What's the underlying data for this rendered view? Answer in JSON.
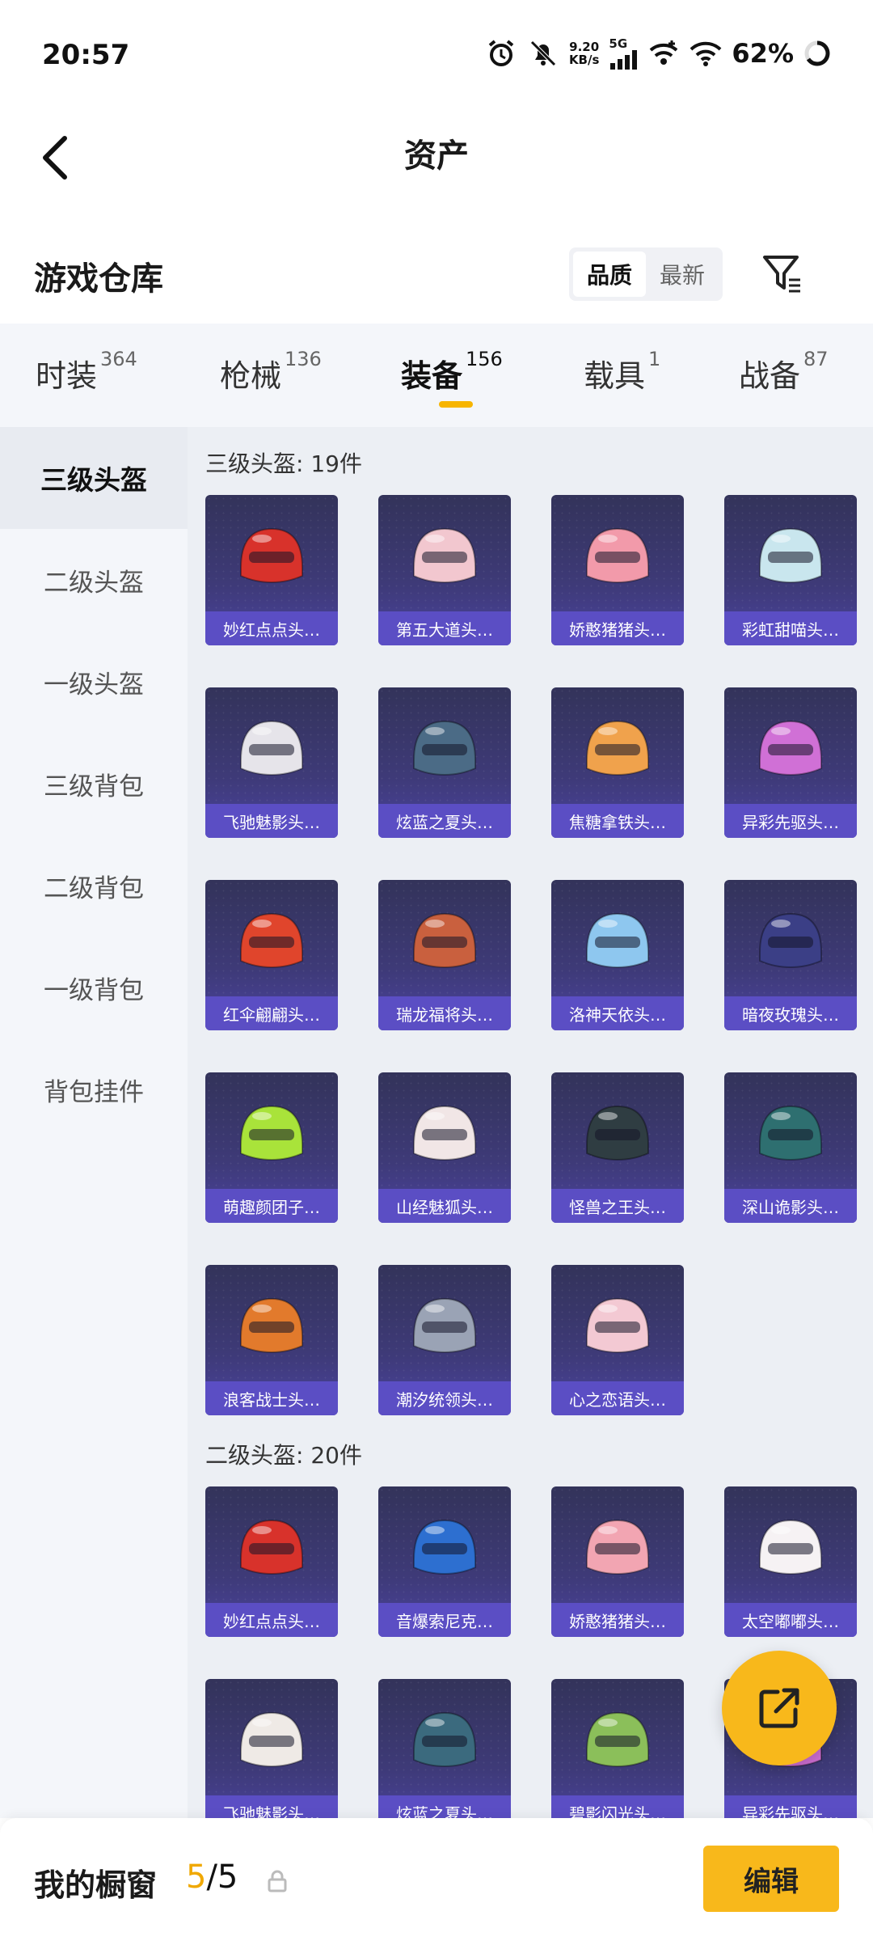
{
  "status": {
    "time": "20:57",
    "net_speed": "9.20",
    "net_unit": "KB/s",
    "net_type": "5G",
    "battery": "62%",
    "icons": [
      "alarm-icon",
      "mute-icon",
      "signal-icon",
      "wifi-calling-icon",
      "wifi-icon",
      "battery-icon"
    ]
  },
  "header": {
    "title": "资产"
  },
  "warehouse": {
    "title": "游戏仓库",
    "sort_options": [
      "品质",
      "最新"
    ],
    "selected_sort": "品质"
  },
  "categories": [
    {
      "label": "时装",
      "count": "364"
    },
    {
      "label": "枪械",
      "count": "136"
    },
    {
      "label": "装备",
      "count": "156",
      "active": true
    },
    {
      "label": "载具",
      "count": "1"
    },
    {
      "label": "战备",
      "count": "87"
    }
  ],
  "sidebar": [
    "三级头盔",
    "二级头盔",
    "一级头盔",
    "三级背包",
    "二级背包",
    "一级背包",
    "背包挂件"
  ],
  "sections": [
    {
      "title": "三级头盔: 19件",
      "items": [
        {
          "name": "妙红点点头…",
          "color": "#d8322b"
        },
        {
          "name": "第五大道头…",
          "color": "#f2c7cf"
        },
        {
          "name": "娇憨猪猪头…",
          "color": "#f29aaa"
        },
        {
          "name": "彩虹甜喵头…",
          "color": "#c9e6ee"
        },
        {
          "name": "飞驰魅影头…",
          "color": "#e6e4ea"
        },
        {
          "name": "炫蓝之夏头…",
          "color": "#4b6b86"
        },
        {
          "name": "焦糖拿铁头…",
          "color": "#f0a24c"
        },
        {
          "name": "异彩先驱头…",
          "color": "#d070d6"
        },
        {
          "name": "红伞翩翩头…",
          "color": "#e0452c"
        },
        {
          "name": "瑞龙福将头…",
          "color": "#c9603e"
        },
        {
          "name": "洛神天依头…",
          "color": "#8ec7ef"
        },
        {
          "name": "暗夜玫瑰头…",
          "color": "#3b3f86"
        },
        {
          "name": "萌趣颜团子…",
          "color": "#a9e33a"
        },
        {
          "name": "山经魅狐头…",
          "color": "#f1e6e6"
        },
        {
          "name": "怪兽之王头…",
          "color": "#2f3d42"
        },
        {
          "name": "深山诡影头…",
          "color": "#2e6f70"
        },
        {
          "name": "浪客战士头…",
          "color": "#e27a2c"
        },
        {
          "name": "潮汐统领头…",
          "color": "#9aa3b5"
        },
        {
          "name": "心之恋语头…",
          "color": "#f3c9d3"
        }
      ]
    },
    {
      "title": "二级头盔: 20件",
      "items": [
        {
          "name": "妙红点点头…",
          "color": "#d8322b"
        },
        {
          "name": "音爆索尼克…",
          "color": "#2d6fd0"
        },
        {
          "name": "娇憨猪猪头…",
          "color": "#f2a5b2"
        },
        {
          "name": "太空嘟嘟头…",
          "color": "#f6f2f4"
        },
        {
          "name": "飞驰魅影头…",
          "color": "#efeae6"
        },
        {
          "name": "炫蓝之夏头…",
          "color": "#3b6a7e"
        },
        {
          "name": "碧影闪光头…",
          "color": "#8bbf5a"
        },
        {
          "name": "异彩先驱头…",
          "color": "#d070d6"
        }
      ]
    }
  ],
  "bottom": {
    "title": "我的橱窗",
    "count_current": "5",
    "count_sep_total": "/5",
    "edit_label": "编辑"
  },
  "accent_color": "#f8b81b"
}
